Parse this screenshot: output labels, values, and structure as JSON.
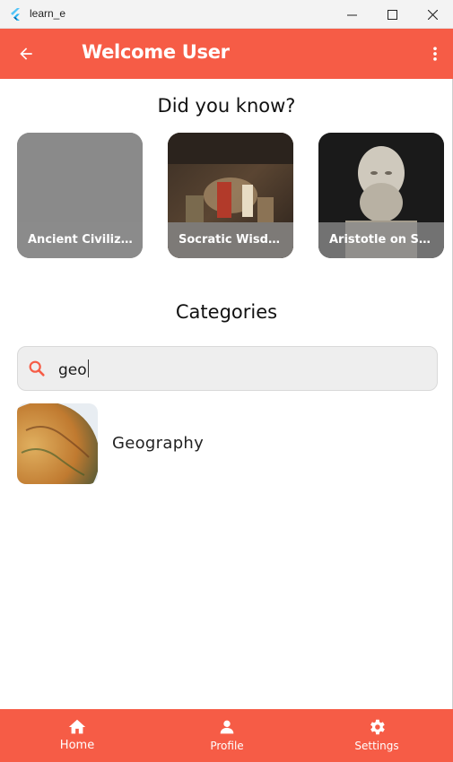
{
  "window": {
    "title": "learn_e",
    "icon": "flutter-icon"
  },
  "appbar": {
    "title": "Welcome User",
    "back_icon": "arrow-back-icon",
    "menu_icon": "more-vert-icon"
  },
  "facts": {
    "heading": "Did you know?",
    "cards": [
      {
        "caption": "Ancient Civiliz..."
      },
      {
        "caption": "Socratic Wisdo..."
      },
      {
        "caption": "Aristotle on Sel..."
      }
    ]
  },
  "categories": {
    "heading": "Categories",
    "search": {
      "value": "geo",
      "icon": "search-icon"
    },
    "items": [
      {
        "label": "Geography",
        "thumb": "globe-image"
      }
    ]
  },
  "bottom_nav": {
    "items": [
      {
        "label": "Home",
        "icon": "home-icon"
      },
      {
        "label": "Profile",
        "icon": "person-icon"
      },
      {
        "label": "Settings",
        "icon": "gear-icon"
      }
    ]
  },
  "colors": {
    "primary": "#f65c46",
    "search_bg": "#eeeeee"
  }
}
